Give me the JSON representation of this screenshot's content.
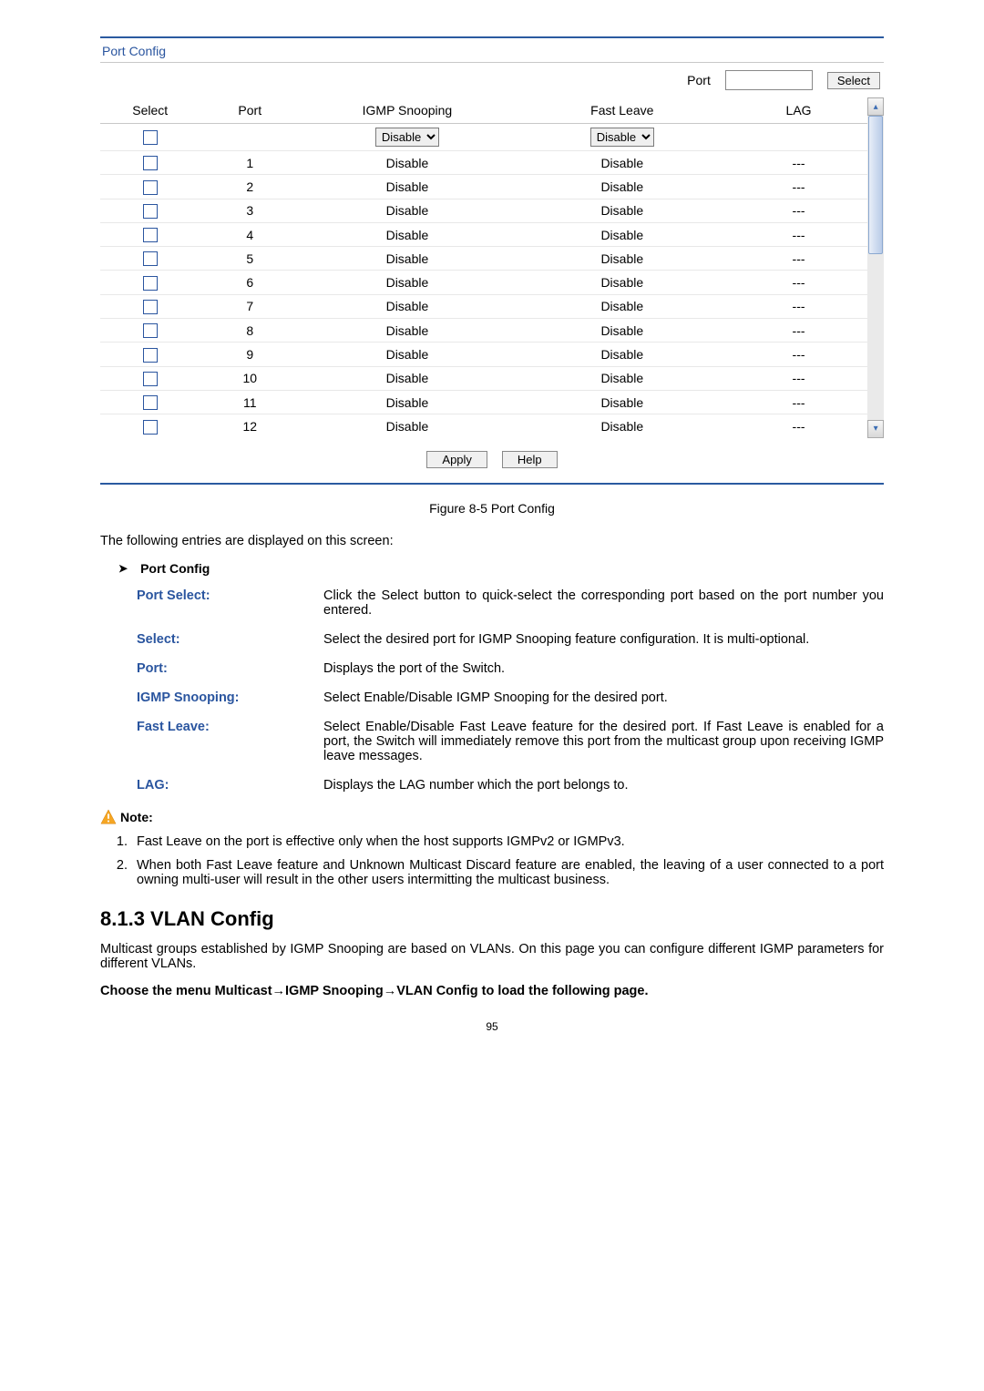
{
  "panel": {
    "title": "Port Config",
    "port_label": "Port",
    "select_btn": "Select",
    "headers": {
      "select": "Select",
      "port": "Port",
      "igmp": "IGMP Snooping",
      "fastleave": "Fast Leave",
      "lag": "LAG"
    },
    "control_row": {
      "igmp_value": "Disable",
      "fastleave_value": "Disable"
    },
    "rows": [
      {
        "port": "1",
        "igmp": "Disable",
        "fastleave": "Disable",
        "lag": "---"
      },
      {
        "port": "2",
        "igmp": "Disable",
        "fastleave": "Disable",
        "lag": "---"
      },
      {
        "port": "3",
        "igmp": "Disable",
        "fastleave": "Disable",
        "lag": "---"
      },
      {
        "port": "4",
        "igmp": "Disable",
        "fastleave": "Disable",
        "lag": "---"
      },
      {
        "port": "5",
        "igmp": "Disable",
        "fastleave": "Disable",
        "lag": "---"
      },
      {
        "port": "6",
        "igmp": "Disable",
        "fastleave": "Disable",
        "lag": "---"
      },
      {
        "port": "7",
        "igmp": "Disable",
        "fastleave": "Disable",
        "lag": "---"
      },
      {
        "port": "8",
        "igmp": "Disable",
        "fastleave": "Disable",
        "lag": "---"
      },
      {
        "port": "9",
        "igmp": "Disable",
        "fastleave": "Disable",
        "lag": "---"
      },
      {
        "port": "10",
        "igmp": "Disable",
        "fastleave": "Disable",
        "lag": "---"
      },
      {
        "port": "11",
        "igmp": "Disable",
        "fastleave": "Disable",
        "lag": "---"
      },
      {
        "port": "12",
        "igmp": "Disable",
        "fastleave": "Disable",
        "lag": "---"
      }
    ],
    "apply_btn": "Apply",
    "help_btn": "Help"
  },
  "figure_caption": "Figure 8-5 Port Config",
  "intro_text": "The following entries are displayed on this screen:",
  "bullet_title": "Port Config",
  "definitions": [
    {
      "term": "Port Select:",
      "desc": "Click the Select button to quick-select the corresponding port based on the port number you entered."
    },
    {
      "term": "Select:",
      "desc": "Select the desired port for IGMP Snooping feature configuration. It is multi-optional."
    },
    {
      "term": "Port:",
      "desc": "Displays the port of the Switch."
    },
    {
      "term": "IGMP Snooping:",
      "desc": "Select Enable/Disable IGMP Snooping for the desired port."
    },
    {
      "term": "Fast Leave:",
      "desc": "Select Enable/Disable Fast Leave feature for the desired port. If Fast Leave is enabled for a port, the Switch will immediately remove this port from the multicast group upon receiving IGMP leave messages."
    },
    {
      "term": "LAG:",
      "desc": "Displays the LAG number which the port belongs to."
    }
  ],
  "note_label": "Note:",
  "notes": [
    "Fast Leave on the port is effective only when the host supports IGMPv2 or IGMPv3.",
    "When both Fast Leave feature and Unknown Multicast Discard feature are enabled, the leaving of a user connected to a port owning multi-user will result in the other users intermitting the multicast business."
  ],
  "section_heading": "8.1.3 VLAN Config",
  "section_body": "Multicast groups established by IGMP Snooping are based on VLANs. On this page you can configure different IGMP parameters for different VLANs.",
  "choose_menu": "Choose the menu Multicast→IGMP Snooping→VLAN Config to load the following page.",
  "page_number": "95"
}
